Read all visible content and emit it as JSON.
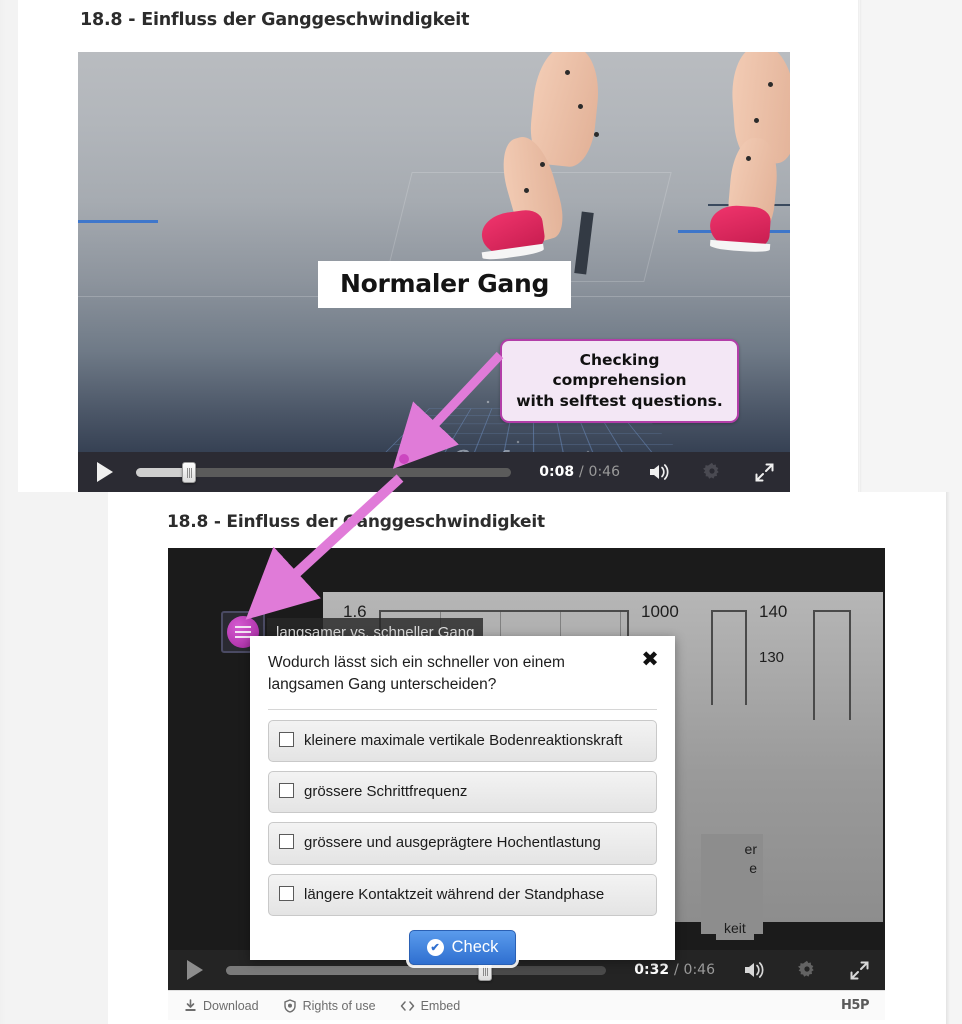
{
  "page": {
    "title_top": "18.8 - Einfluss der Ganggeschwindigkeit",
    "title_bottom": "18.8 - Einfluss der Ganggeschwindigkeit"
  },
  "video_top": {
    "overlay_caption": "Normaler Gang",
    "current_time": "0:08",
    "separator": "/",
    "duration": "0:46",
    "play_icon": "play-icon",
    "volume_icon": "volume-icon",
    "settings_icon": "gear-icon",
    "fullscreen_icon": "fullscreen-icon",
    "progress_percent": 14
  },
  "annotation": {
    "callout_line1": "Checking comprehension",
    "callout_line2": "with selftest questions.",
    "border_color": "#b23ea8",
    "fill_color": "#f3e7f5",
    "arrow_color": "#e07bd8"
  },
  "video_bottom": {
    "current_time": "0:32",
    "separator": "/",
    "duration": "0:46",
    "play_icon": "play-icon",
    "volume_icon": "volume-icon",
    "settings_icon": "gear-icon",
    "fullscreen_icon": "fullscreen-icon",
    "progress_percent": 68,
    "bookmark_label": "langsamer vs. schneller Gang",
    "bookmark_icon": "bookmark-list-icon",
    "side_chip_line1": "er",
    "side_chip_line2": "e",
    "bottom_chip": "keit"
  },
  "chart_data": {
    "type": "bar",
    "title": "",
    "axis_labels": [
      "1.6",
      "1000",
      "140",
      "130"
    ],
    "categories": [
      "1.6",
      "1000",
      "140"
    ],
    "values": [
      1.6,
      1000,
      140
    ],
    "grid": true,
    "legend": "none"
  },
  "quiz": {
    "question": "Wodurch lässt sich ein schneller von einem langsamen Gang unterscheiden?",
    "close_icon": "close-icon",
    "options": [
      "kleinere maximale vertikale Bodenreaktionskraft",
      "grössere Schrittfrequenz",
      "grössere und ausgeprägtere Hochentlastung",
      "längere Kontaktzeit während der Standphase"
    ],
    "check_label": "Check",
    "check_icon": "check-circle-icon",
    "check_color": "#2f6fd0"
  },
  "h5p_bar": {
    "download": "Download",
    "rights": "Rights of use",
    "embed": "Embed",
    "logo": "H5P",
    "download_icon": "download-icon",
    "rights_icon": "shield-icon",
    "embed_icon": "code-icon"
  }
}
